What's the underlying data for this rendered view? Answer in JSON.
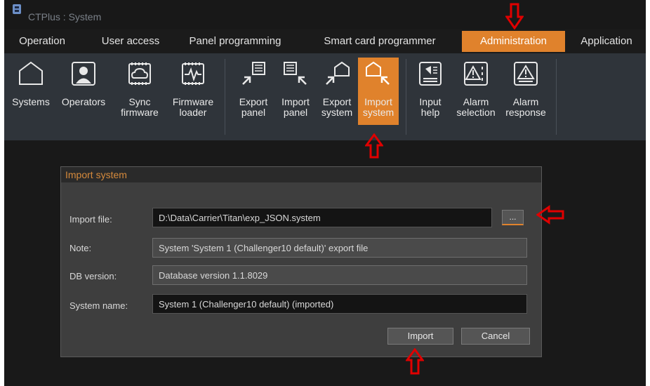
{
  "window": {
    "title": "CTPlus : System"
  },
  "menu": {
    "tabs": [
      {
        "label": "Operation"
      },
      {
        "label": "User access"
      },
      {
        "label": "Panel programming"
      },
      {
        "label": "Smart card programmer"
      },
      {
        "label": "Administration",
        "active": true
      },
      {
        "label": "Application"
      }
    ]
  },
  "ribbon": {
    "buttons": [
      {
        "label": "Systems",
        "icon": "pentagon-house-icon"
      },
      {
        "label": "Operators",
        "icon": "user-card-icon"
      },
      {
        "label": "Sync\nfirmware",
        "icon": "cloud-chip-icon"
      },
      {
        "label": "Firmware\nloader",
        "icon": "chip-pulse-icon"
      },
      {
        "label": "Export\npanel",
        "icon": "export-panel-icon"
      },
      {
        "label": "Import\npanel",
        "icon": "import-panel-icon"
      },
      {
        "label": "Export\nsystem",
        "icon": "export-system-icon"
      },
      {
        "label": "Import\nsystem",
        "icon": "import-system-icon",
        "active": true
      },
      {
        "label": "Input\nhelp",
        "icon": "input-help-icon"
      },
      {
        "label": "Alarm\nselection",
        "icon": "alarm-selection-icon"
      },
      {
        "label": "Alarm\nresponse",
        "icon": "alarm-response-icon"
      }
    ]
  },
  "dialog": {
    "title": "Import system",
    "import_file": {
      "label": "Import file:",
      "value": "D:\\Data\\Carrier\\Titan\\exp_JSON.system"
    },
    "browse_label": "...",
    "note": {
      "label": "Note:",
      "value": "System 'System 1 (Challenger10 default)' export file"
    },
    "db_version": {
      "label": "DB version:",
      "value": "Database version 1.1.8029"
    },
    "system_name": {
      "label": "System name:",
      "value": "System 1 (Challenger10 default) (imported)"
    },
    "import_button": "Import",
    "cancel_button": "Cancel"
  },
  "colors": {
    "accent": "#e0822c",
    "annotation": "#e00000",
    "ribbon": "#2f343a",
    "dialog": "#3e3e3e"
  }
}
